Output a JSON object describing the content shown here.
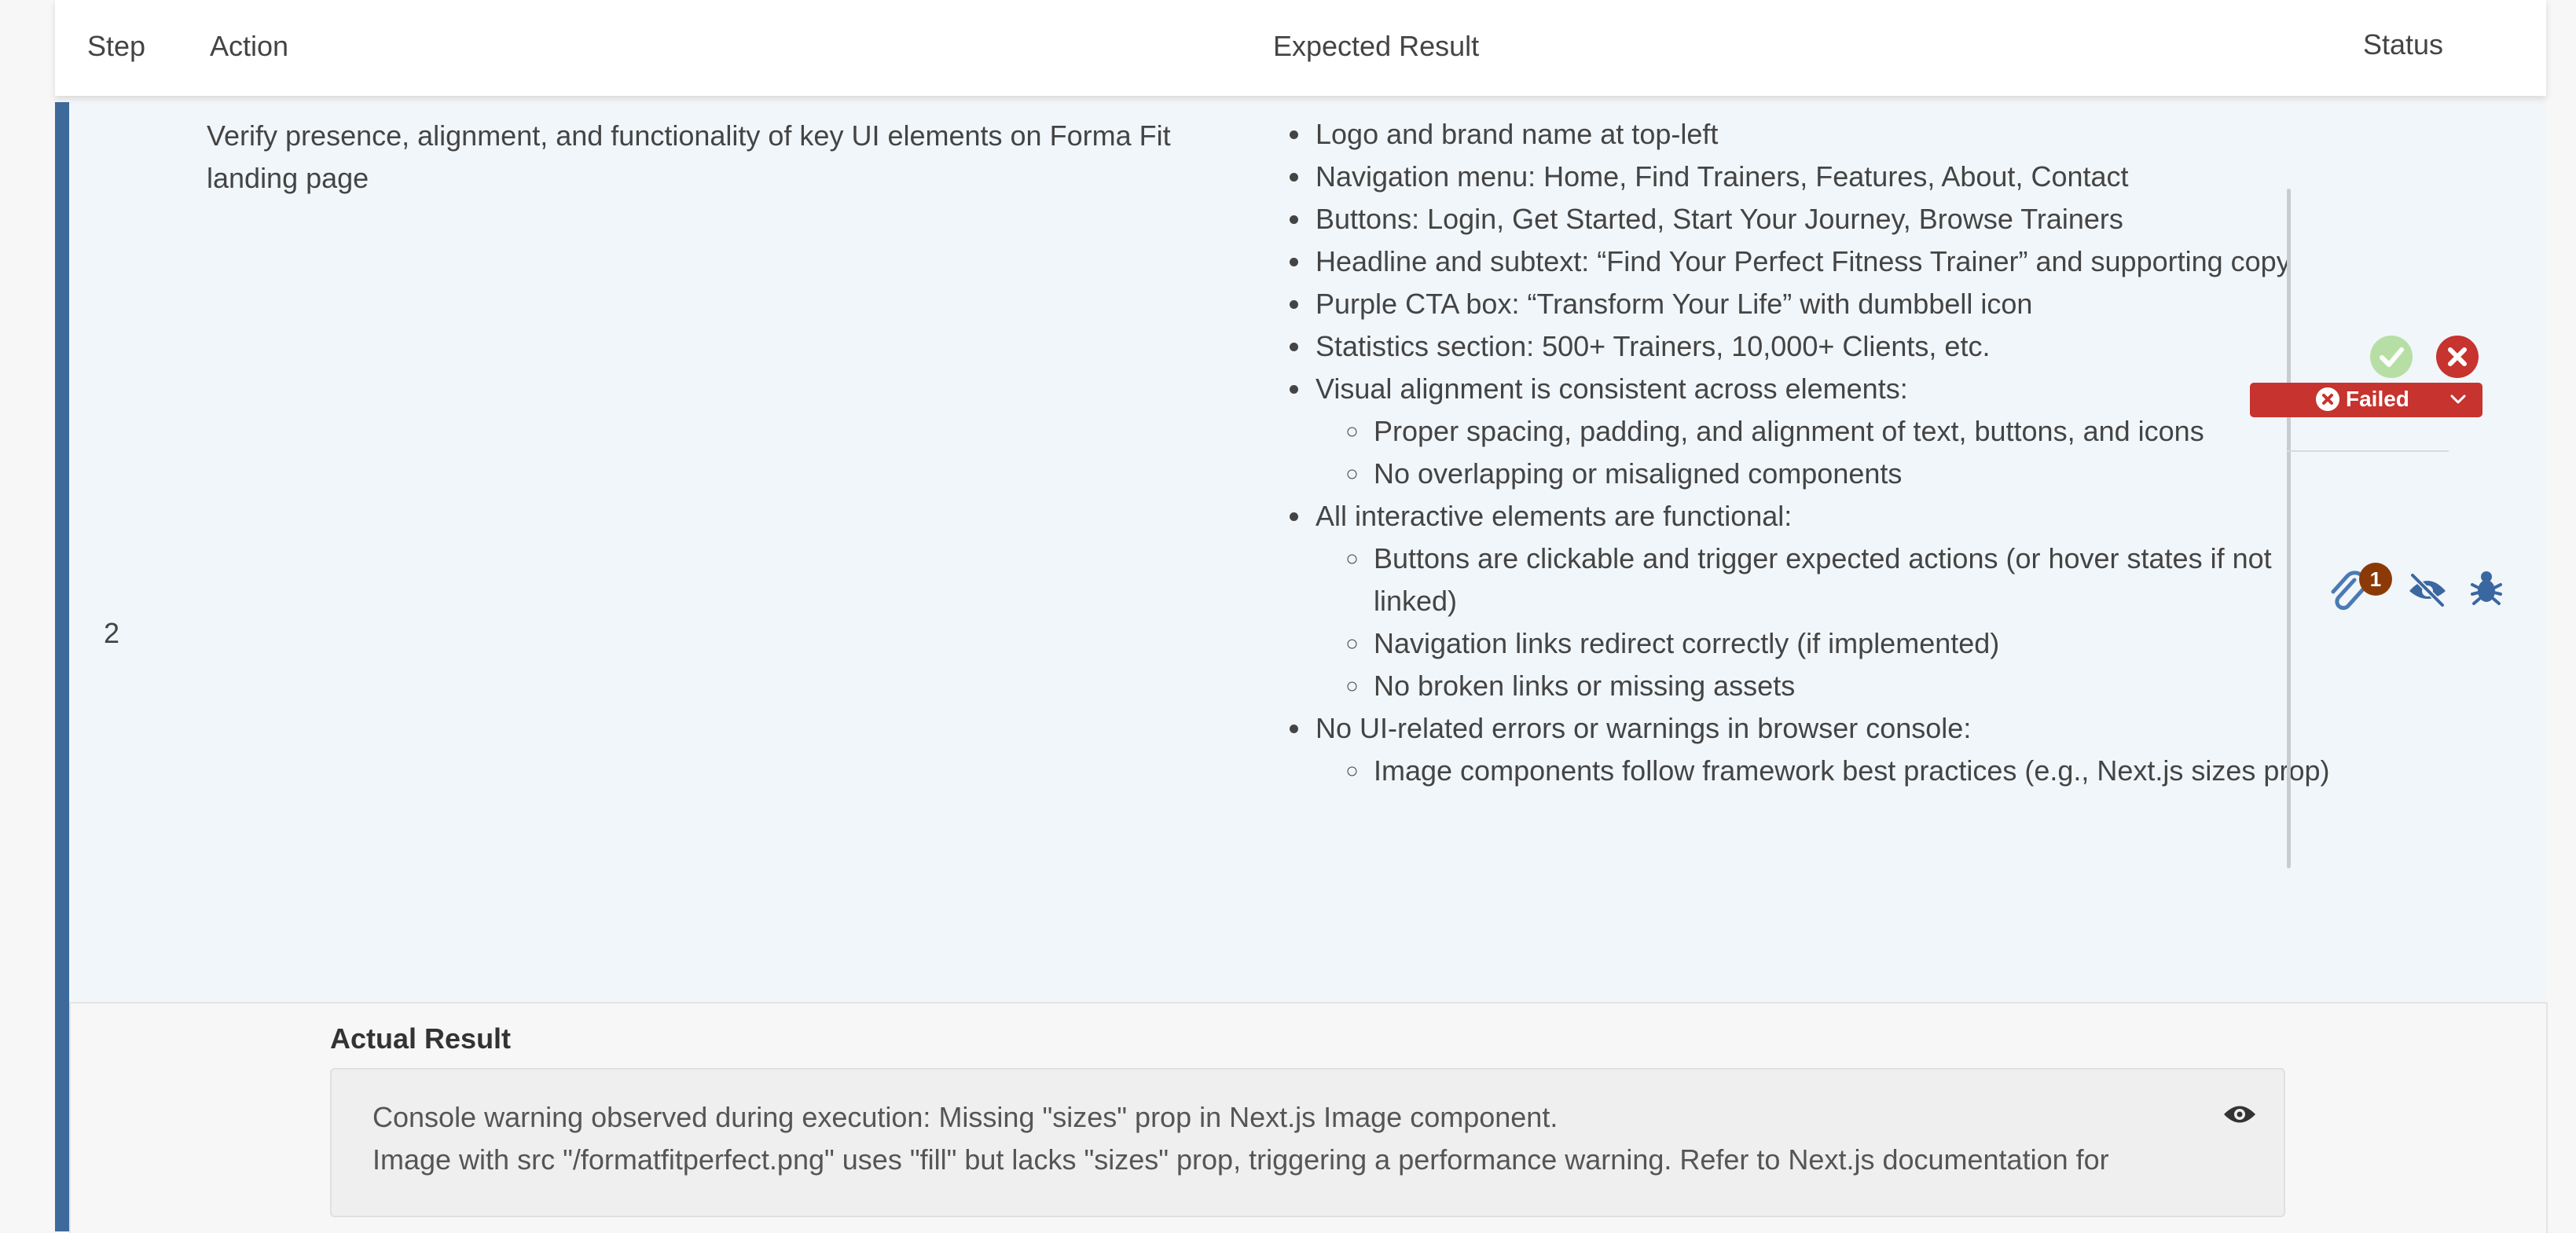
{
  "header": {
    "step": "Step",
    "action": "Action",
    "expected": "Expected Result",
    "status": "Status"
  },
  "row": {
    "step_number": "2",
    "action": "Verify presence, alignment, and functionality of key UI elements on Forma Fit landing page",
    "expected": {
      "items": [
        "Logo and brand name at top-left",
        "Navigation menu: Home, Find Trainers, Features, About, Contact",
        "Buttons: Login, Get Started, Start Your Journey, Browse Trainers",
        "Headline and subtext: “Find Your Perfect Fitness Trainer” and supporting copy",
        "Purple CTA box: “Transform Your Life” with dumbbell icon",
        "Statistics section: 500+ Trainers, 10,000+ Clients, etc.",
        "Visual alignment is consistent across elements:",
        "All interactive elements are functional:",
        "No UI-related errors or warnings in browser console:"
      ],
      "alignment_sub": [
        "Proper spacing, padding, and alignment of text, buttons, and icons",
        "No overlapping or misaligned components"
      ],
      "interactive_sub": [
        "Buttons are clickable and trigger expected actions (or hover states if not linked)",
        "Navigation links redirect correctly (if implemented)",
        "No broken links or missing assets"
      ],
      "console_sub": [
        "Image components follow framework best practices (e.g., Next.js sizes prop)"
      ]
    },
    "status": {
      "label": "Failed",
      "attachment_count": "1",
      "colors": {
        "failed": "#c7332e",
        "passed_light": "#b7dfa5",
        "accent": "#3e6a9b",
        "badge": "#8b3a07"
      }
    }
  },
  "actual_result": {
    "title": "Actual Result",
    "line1": "Console warning observed during execution: Missing \"sizes\" prop in Next.js Image component.",
    "line2": "Image with src \"/formatfitperfect.png\" uses \"fill\" but lacks \"sizes\" prop, triggering a performance warning. Refer to Next.js documentation for"
  }
}
